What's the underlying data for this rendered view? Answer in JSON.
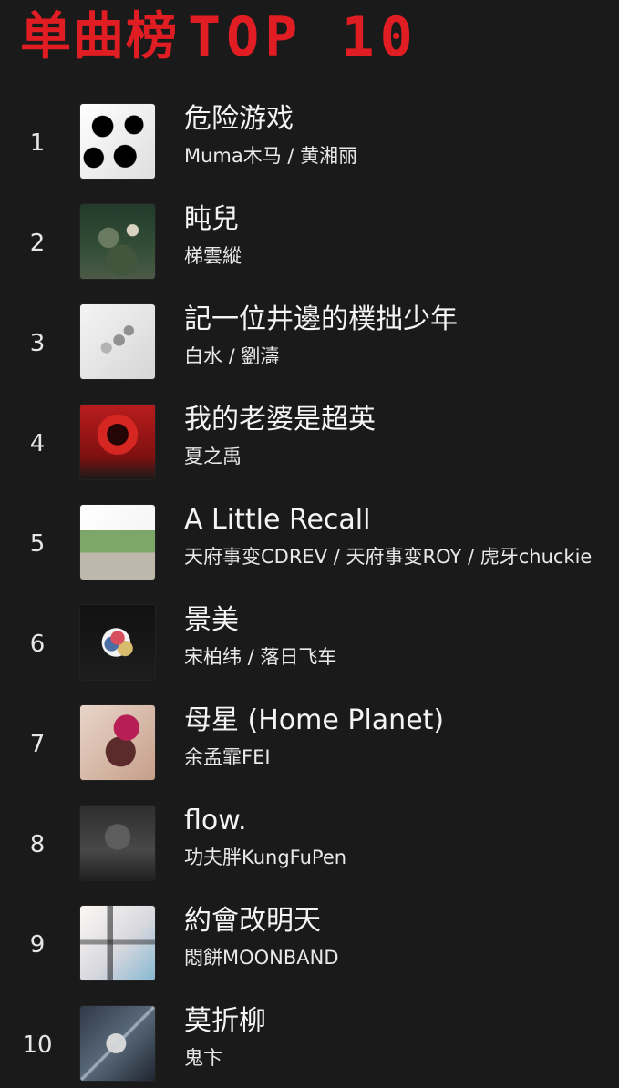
{
  "header": {
    "title_zh": "单曲榜",
    "title_en": "TOP 10"
  },
  "chart": {
    "items": [
      {
        "rank": "1",
        "song": "危险游戏",
        "artist": "Muma木马 / 黄湘丽"
      },
      {
        "rank": "2",
        "song": "盹兒",
        "artist": "梯雲縱"
      },
      {
        "rank": "3",
        "song": "記一位井邊的樸拙少年",
        "artist": "白水 / 劉濤"
      },
      {
        "rank": "4",
        "song": "我的老婆是超英",
        "artist": "夏之禹"
      },
      {
        "rank": "5",
        "song": "A Little Recall",
        "artist": "天府事变CDREV / 天府事变ROY / 虎牙chuckie"
      },
      {
        "rank": "6",
        "song": "景美",
        "artist": "宋柏纬 / 落日飞车"
      },
      {
        "rank": "7",
        "song": "母星 (Home Planet)",
        "artist": "余孟霏FEI"
      },
      {
        "rank": "8",
        "song": "flow.",
        "artist": "功夫胖KungFuPen"
      },
      {
        "rank": "9",
        "song": "約會改明天",
        "artist": "悶餅MOONBAND"
      },
      {
        "rank": "10",
        "song": "莫折柳",
        "artist": "鬼卞"
      }
    ]
  }
}
